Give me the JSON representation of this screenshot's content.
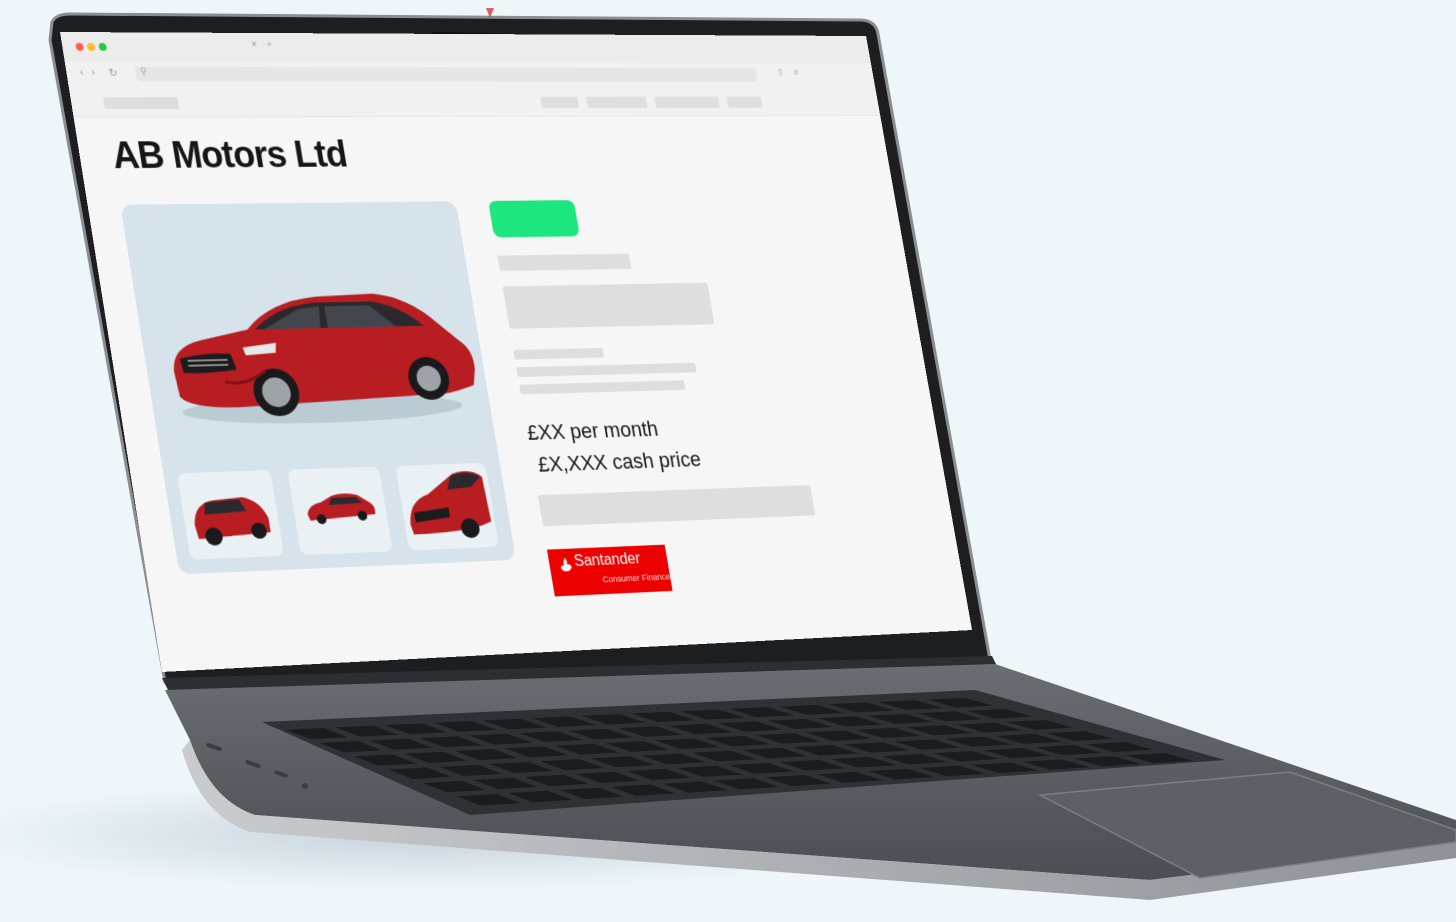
{
  "browser": {
    "tab_close": "×",
    "tab_new": "+",
    "back_icon": "‹",
    "forward_icon": "›",
    "reload_icon": "↻",
    "search_icon": "⚲",
    "share_icon": "⇧",
    "menu_icon": "≡"
  },
  "site": {
    "title": "AB Motors Ltd",
    "monthly_price": "£XX per month",
    "cash_price": "£X,XXX cash price",
    "finance_badge": {
      "name": "Santander",
      "subtitle": "Consumer Finance"
    }
  },
  "colors": {
    "accent_green": "#1ee67f",
    "santander_red": "#ec0000",
    "car_red": "#b81d22",
    "laptop_body": "#55585c",
    "background": "#eef6fa"
  }
}
